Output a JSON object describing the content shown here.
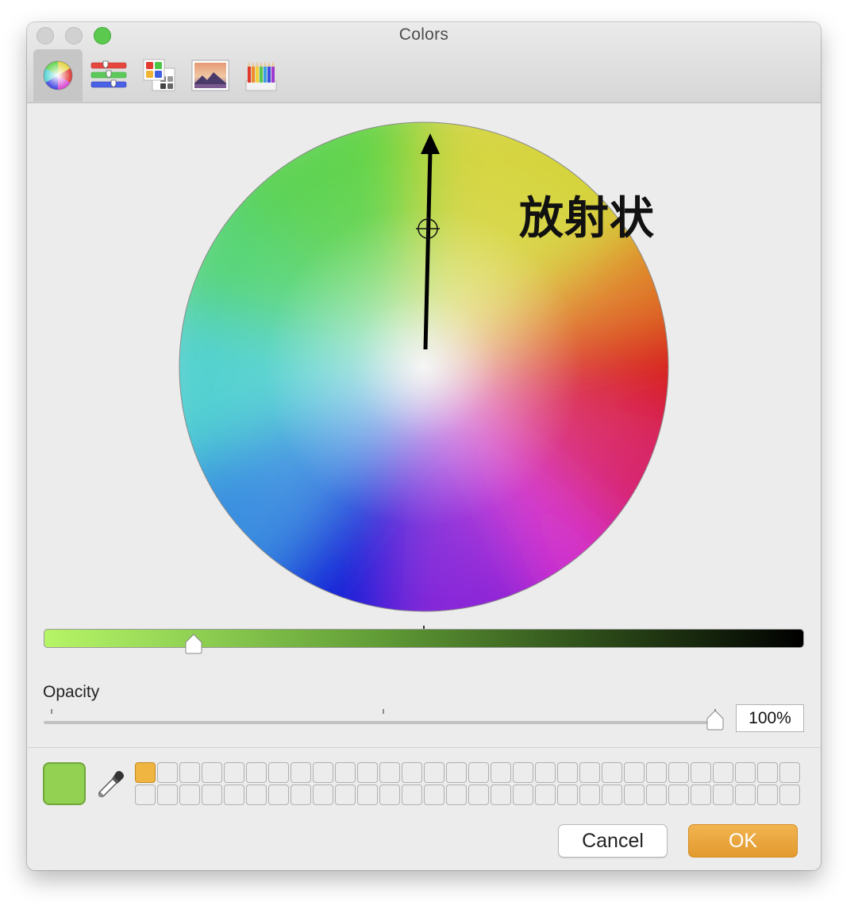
{
  "window": {
    "title": "Colors"
  },
  "toolbar": {
    "tabs": [
      {
        "icon": "color-wheel-icon",
        "selected": true
      },
      {
        "icon": "color-sliders-icon",
        "selected": false
      },
      {
        "icon": "color-palettes-icon",
        "selected": false
      },
      {
        "icon": "image-palettes-icon",
        "selected": false
      },
      {
        "icon": "pencils-icon",
        "selected": false
      }
    ]
  },
  "wheel": {
    "annotation_label": "放射状",
    "selected_color": "#93d152"
  },
  "brightness": {
    "value": 0.19
  },
  "opacity": {
    "label": "Opacity",
    "value": "100%",
    "fraction": 1.0
  },
  "swatches": {
    "current_color": "#93d152",
    "saved_colors": [
      "#f0b440"
    ]
  },
  "buttons": {
    "cancel": "Cancel",
    "ok": "OK"
  },
  "colors": {
    "accent": "#e6a034",
    "window_bg": "#ececec"
  }
}
